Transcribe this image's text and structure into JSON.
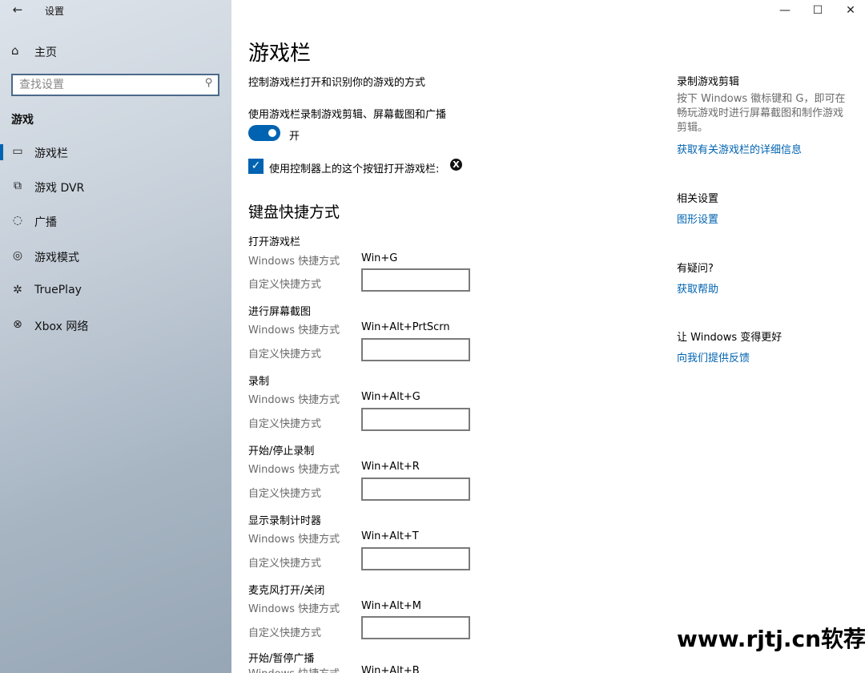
{
  "window": {
    "title": "设置",
    "minimize_icon": "—",
    "maximize_icon": "☐",
    "close_icon": "✕"
  },
  "sidebar": {
    "home_label": "主页",
    "search_placeholder": "查找设置",
    "section_title": "游戏",
    "items": [
      {
        "label": "游戏栏",
        "icon": "gamebar-icon",
        "active": true
      },
      {
        "label": "游戏 DVR",
        "icon": "dvr-icon",
        "active": false
      },
      {
        "label": "广播",
        "icon": "broadcast-icon",
        "active": false
      },
      {
        "label": "游戏模式",
        "icon": "gamemode-icon",
        "active": false
      },
      {
        "label": "TruePlay",
        "icon": "trueplay-icon",
        "active": false
      },
      {
        "label": "Xbox 网络",
        "icon": "xbox-icon",
        "active": false
      }
    ]
  },
  "main": {
    "title": "游戏栏",
    "subtitle": "控制游戏栏打开和识别你的游戏的方式",
    "record_label": "使用游戏栏录制游戏剪辑、屏幕截图和广播",
    "toggle_state": "开",
    "toggle_on": true,
    "controller_checkbox_label": "使用控制器上的这个按钮打开游戏栏:",
    "controller_checkbox_checked": true,
    "keyboard_heading": "键盘快捷方式",
    "windows_shortcut_label": "Windows 快捷方式",
    "custom_shortcut_label": "自定义快捷方式",
    "shortcuts": [
      {
        "name": "打开游戏栏",
        "keys": "Win+G",
        "custom": ""
      },
      {
        "name": "进行屏幕截图",
        "keys": "Win+Alt+PrtScrn",
        "custom": ""
      },
      {
        "name": "录制",
        "keys": "Win+Alt+G",
        "custom": ""
      },
      {
        "name": "开始/停止录制",
        "keys": "Win+Alt+R",
        "custom": ""
      },
      {
        "name": "显示录制计时器",
        "keys": "Win+Alt+T",
        "custom": ""
      },
      {
        "name": "麦克风打开/关闭",
        "keys": "Win+Alt+M",
        "custom": ""
      },
      {
        "name": "开始/暂停广播",
        "keys": "Win+Alt+B",
        "custom": ""
      }
    ]
  },
  "right": {
    "record_clip_heading": "录制游戏剪辑",
    "record_clip_desc": "按下 Windows 徽标键和 G，即可在畅玩游戏时进行屏幕截图和制作游戏剪辑。",
    "record_clip_link": "获取有关游戏栏的详细信息",
    "related_heading": "相关设置",
    "related_link": "图形设置",
    "question_heading": "有疑问?",
    "question_link": "获取帮助",
    "improve_heading": "让 Windows 变得更好",
    "improve_link": "向我们提供反馈"
  },
  "watermark": "www.rjtj.cn软荐网",
  "colors": {
    "accent": "#0063b1"
  }
}
